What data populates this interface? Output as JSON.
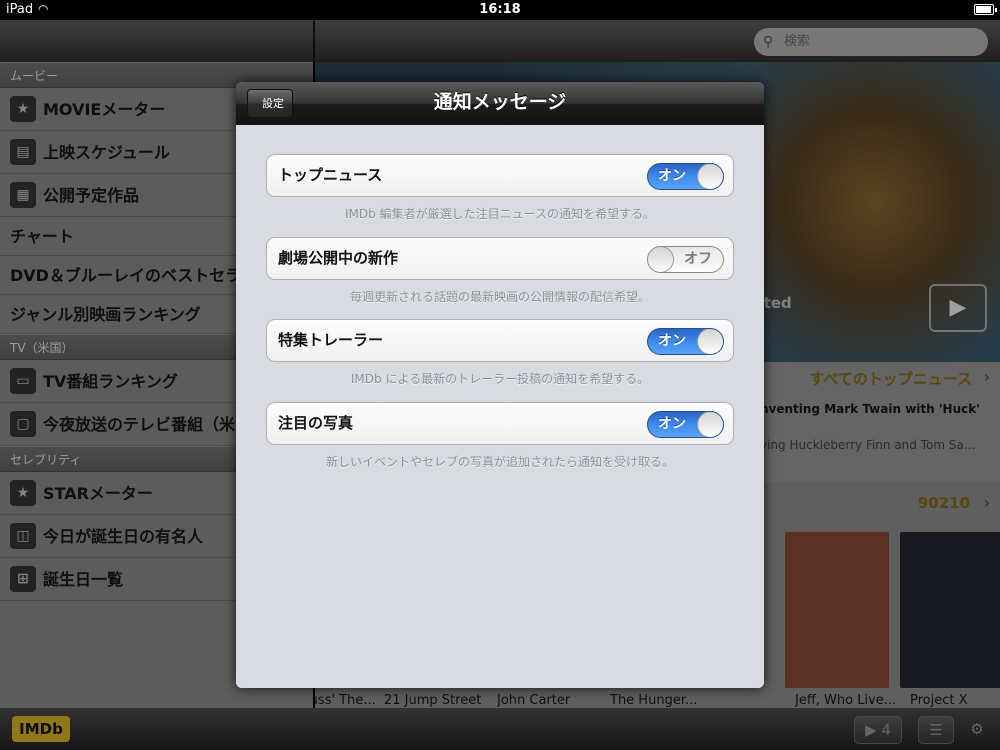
{
  "status": {
    "carrier": "iPad",
    "time": "16:18"
  },
  "search": {
    "placeholder": "検索"
  },
  "sidebar": {
    "sections": [
      {
        "header": "ムービー"
      },
      {
        "header": "TV（米国）"
      },
      {
        "header": "セレブリティ"
      }
    ],
    "movie_items": [
      "MOVIEメーター",
      "上映スケジュール",
      "公開予定作品"
    ],
    "plain_items": [
      "チャート",
      "DVD＆ブルーレイのベストセラー",
      "ジャンル別映画ランキング"
    ],
    "tv_items": [
      "TV番組ランキング",
      "今夜放送のテレビ番組（米国）"
    ],
    "celeb_items": [
      "STARメーター",
      "今日が誕生日の有名人",
      "誕生日一覧"
    ]
  },
  "content": {
    "hero_label": "nted",
    "all_news_label": "すべてのトップニュース",
    "headline": "nventing Mark Twain with 'Huck'",
    "subline": "ving Huckleberry Finn and Tom Sa...",
    "zip": "90210",
    "posters": [
      {
        "title": "Dr. Seuss' The...",
        "color": "#2a3a4a"
      },
      {
        "title": "21 Jump Street",
        "color": "#3a2a22"
      },
      {
        "title": "John Carter",
        "color": "#4a3a20"
      },
      {
        "title": "The Hunger...",
        "color": "#2a2a2a"
      },
      {
        "title": "Jeff, Who Live...",
        "color": "#6a3a2a"
      },
      {
        "title": "Project X",
        "color": "#1e1e26"
      }
    ]
  },
  "toolbar": {
    "logo": "IMDb",
    "queue_count": "4"
  },
  "modal": {
    "title": "通知メッセージ",
    "back_label": "設定",
    "settings": [
      {
        "label": "トップニュース",
        "state": "オン",
        "on": true,
        "note": "IMDb 編集者が厳選した注目ニュースの通知を希望する。"
      },
      {
        "label": "劇場公開中の新作",
        "state": "オフ",
        "on": false,
        "note": "毎週更新される話題の最新映画の公開情報の配信希望。"
      },
      {
        "label": "特集トレーラー",
        "state": "オン",
        "on": true,
        "note": "IMDb による最新のトレーラー投稿の通知を希望する。"
      },
      {
        "label": "注目の写真",
        "state": "オン",
        "on": true,
        "note": "新しいイベントやセレブの写真が追加されたら通知を受け取る。"
      }
    ]
  },
  "colors": {
    "accent_blue": "#3f8ef0",
    "imdb_yellow": "#a98e22"
  }
}
